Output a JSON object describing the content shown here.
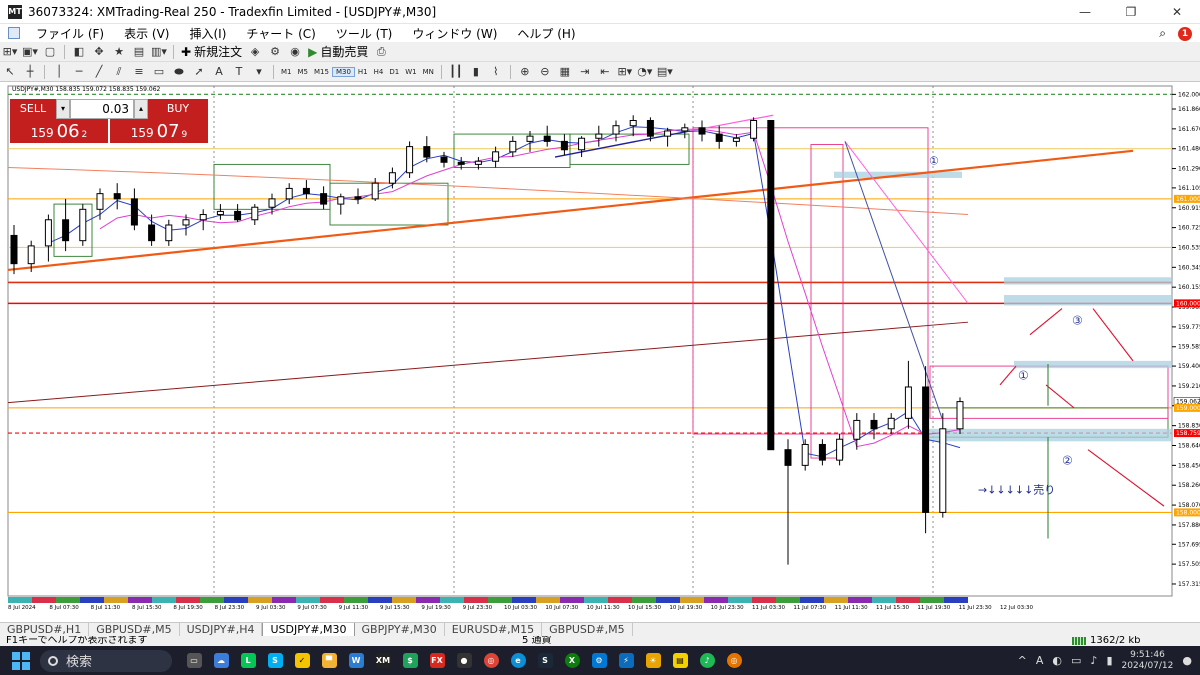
{
  "window": {
    "title": "36073324: XMTrading-Real 250 - Tradexfin Limited - [USDJPY#,M30]",
    "app_badge": "MT"
  },
  "menu": [
    "ファイル (F)",
    "表示 (V)",
    "挿入(I)",
    "チャート (C)",
    "ツール (T)",
    "ウィンドウ (W)",
    "ヘルプ (H)"
  ],
  "toolbar": {
    "new_order": "新規注文",
    "auto_trade": "自動売買",
    "timeframes": [
      "M1",
      "M5",
      "M15",
      "M30",
      "H1",
      "H4",
      "D1",
      "W1",
      "MN"
    ],
    "selected_timeframe": "M30",
    "notification_count": "1"
  },
  "chart_info": "USDJPY#,M30 158.835 159.072 158.835 159.062",
  "trade_panel": {
    "sell_label": "SELL",
    "buy_label": "BUY",
    "lot": "0.03",
    "sell_prefix": "159",
    "sell_big": "06",
    "sell_sup": "2",
    "buy_prefix": "159",
    "buy_big": "07",
    "buy_sup": "9"
  },
  "annotations": {
    "circle1_top": "①",
    "circle1": "①",
    "circle2": "②",
    "circle3": "③",
    "sell_note": "→↓↓↓↓↓売り"
  },
  "chart_data": {
    "type": "candlestick",
    "symbol": "USDJPY#",
    "timeframe": "M30",
    "y_ticks": [
      162.0,
      161.86,
      161.67,
      161.48,
      161.29,
      161.105,
      160.915,
      160.725,
      160.535,
      160.345,
      160.155,
      159.965,
      159.775,
      159.585,
      159.4,
      159.21,
      159.02,
      158.83,
      158.64,
      158.45,
      158.26,
      158.07,
      157.88,
      157.695,
      157.505,
      157.315
    ],
    "y_tick_labels": [
      "162.000",
      "161.860",
      "161.670",
      "161.480",
      "161.290",
      "161.105",
      "160.915",
      "160.725",
      "160.535",
      "160.345",
      "160.155",
      "159.965",
      "159.775",
      "159.585",
      "159.400",
      "159.210",
      "159.020",
      "158.830",
      "158.640",
      "158.450",
      "158.260",
      "158.070",
      "157.880",
      "157.695",
      "157.505",
      "157.315"
    ],
    "ylim": [
      157.2,
      162.08
    ],
    "x_labels": [
      "8 Jul 2024",
      "8 Jul 07:30",
      "8 Jul 11:30",
      "8 Jul 15:30",
      "8 Jul 19:30",
      "8 Jul 23:30",
      "9 Jul 03:30",
      "9 Jul 07:30",
      "9 Jul 11:30",
      "9 Jul 15:30",
      "9 Jul 19:30",
      "9 Jul 23:30",
      "10 Jul 03:30",
      "10 Jul 07:30",
      "10 Jul 11:30",
      "10 Jul 15:30",
      "10 Jul 19:30",
      "10 Jul 23:30",
      "11 Jul 03:30",
      "11 Jul 07:30",
      "11 Jul 11:30",
      "11 Jul 15:30",
      "11 Jul 19:30",
      "11 Jul 23:30",
      "12 Jul 03:30"
    ],
    "price_tags": [
      {
        "value": 161.0,
        "label": "161.000",
        "color": "#ffa500"
      },
      {
        "value": 160.0,
        "label": "160.000",
        "color": "#ff0000"
      },
      {
        "value": 159.062,
        "label": "159.062",
        "color": "#ffffff"
      },
      {
        "value": 159.0,
        "label": "159.000",
        "color": "#ffa500"
      },
      {
        "value": 158.759,
        "label": "158.759",
        "color": "#ff0000"
      },
      {
        "value": 158.0,
        "label": "158.000",
        "color": "#ffa500"
      }
    ],
    "horizontal_levels": [
      {
        "value": 162.0,
        "color": "#2e8b2e",
        "style": "dashed"
      },
      {
        "value": 161.48,
        "color": "#f0d070",
        "style": "solid"
      },
      {
        "value": 161.0,
        "color": "#ffa500",
        "style": "solid"
      },
      {
        "value": 160.535,
        "color": "#f0d070",
        "style": "solid"
      },
      {
        "value": 160.2,
        "color": "#e03010",
        "style": "solid"
      },
      {
        "value": 160.0,
        "color": "#ff0000",
        "style": "solid"
      },
      {
        "value": 159.0,
        "color": "#ffa500",
        "style": "solid"
      },
      {
        "value": 158.759,
        "color": "#ff0000",
        "style": "dashed"
      },
      {
        "value": 158.0,
        "color": "#ffa500",
        "style": "solid"
      }
    ],
    "candles_ohlc": [
      [
        160.65,
        160.75,
        160.28,
        160.38
      ],
      [
        160.38,
        160.6,
        160.3,
        160.55
      ],
      [
        160.55,
        160.85,
        160.4,
        160.8
      ],
      [
        160.8,
        161.0,
        160.5,
        160.6
      ],
      [
        160.6,
        160.95,
        160.55,
        160.9
      ],
      [
        160.9,
        161.1,
        160.8,
        161.05
      ],
      [
        161.05,
        161.15,
        160.9,
        161.0
      ],
      [
        161.0,
        161.1,
        160.7,
        160.75
      ],
      [
        160.75,
        160.85,
        160.55,
        160.6
      ],
      [
        160.6,
        160.8,
        160.55,
        160.75
      ],
      [
        160.75,
        160.85,
        160.65,
        160.8
      ],
      [
        160.8,
        160.9,
        160.7,
        160.85
      ],
      [
        160.85,
        160.95,
        160.8,
        160.88
      ],
      [
        160.88,
        160.95,
        160.78,
        160.8
      ],
      [
        160.8,
        160.95,
        160.75,
        160.92
      ],
      [
        160.92,
        161.05,
        160.85,
        161.0
      ],
      [
        161.0,
        161.15,
        160.95,
        161.1
      ],
      [
        161.1,
        161.18,
        161.0,
        161.05
      ],
      [
        161.05,
        161.12,
        160.9,
        160.95
      ],
      [
        160.95,
        161.05,
        160.85,
        161.02
      ],
      [
        161.02,
        161.1,
        160.95,
        161.0
      ],
      [
        161.0,
        161.2,
        160.98,
        161.15
      ],
      [
        161.15,
        161.3,
        161.1,
        161.25
      ],
      [
        161.25,
        161.55,
        161.2,
        161.5
      ],
      [
        161.5,
        161.6,
        161.35,
        161.4
      ],
      [
        161.4,
        161.45,
        161.3,
        161.35
      ],
      [
        161.35,
        161.4,
        161.28,
        161.33
      ],
      [
        161.33,
        161.4,
        161.28,
        161.36
      ],
      [
        161.36,
        161.5,
        161.3,
        161.45
      ],
      [
        161.45,
        161.6,
        161.4,
        161.55
      ],
      [
        161.55,
        161.65,
        161.45,
        161.6
      ],
      [
        161.6,
        161.7,
        161.5,
        161.55
      ],
      [
        161.55,
        161.62,
        161.42,
        161.47
      ],
      [
        161.47,
        161.6,
        161.4,
        161.58
      ],
      [
        161.58,
        161.7,
        161.5,
        161.62
      ],
      [
        161.62,
        161.75,
        161.55,
        161.7
      ],
      [
        161.7,
        161.8,
        161.6,
        161.75
      ],
      [
        161.75,
        161.78,
        161.55,
        161.6
      ],
      [
        161.6,
        161.68,
        161.5,
        161.65
      ],
      [
        161.65,
        161.72,
        161.58,
        161.68
      ],
      [
        161.68,
        161.75,
        161.55,
        161.62
      ],
      [
        161.62,
        161.7,
        161.48,
        161.55
      ],
      [
        161.55,
        161.62,
        161.5,
        161.58
      ],
      [
        161.58,
        161.78,
        161.55,
        161.75
      ],
      [
        161.75,
        161.73,
        161.35,
        158.6
      ],
      [
        158.6,
        158.7,
        157.5,
        158.45
      ],
      [
        158.45,
        158.7,
        158.4,
        158.65
      ],
      [
        158.65,
        158.7,
        158.45,
        158.5
      ],
      [
        158.5,
        158.75,
        158.45,
        158.7
      ],
      [
        158.7,
        158.95,
        158.6,
        158.88
      ],
      [
        158.88,
        158.95,
        158.7,
        158.8
      ],
      [
        158.8,
        158.95,
        158.75,
        158.9
      ],
      [
        158.9,
        159.45,
        158.8,
        159.2
      ],
      [
        159.2,
        159.4,
        157.8,
        158.0
      ],
      [
        158.0,
        158.95,
        157.95,
        158.8
      ],
      [
        158.8,
        159.1,
        158.75,
        159.06
      ]
    ]
  }
}
